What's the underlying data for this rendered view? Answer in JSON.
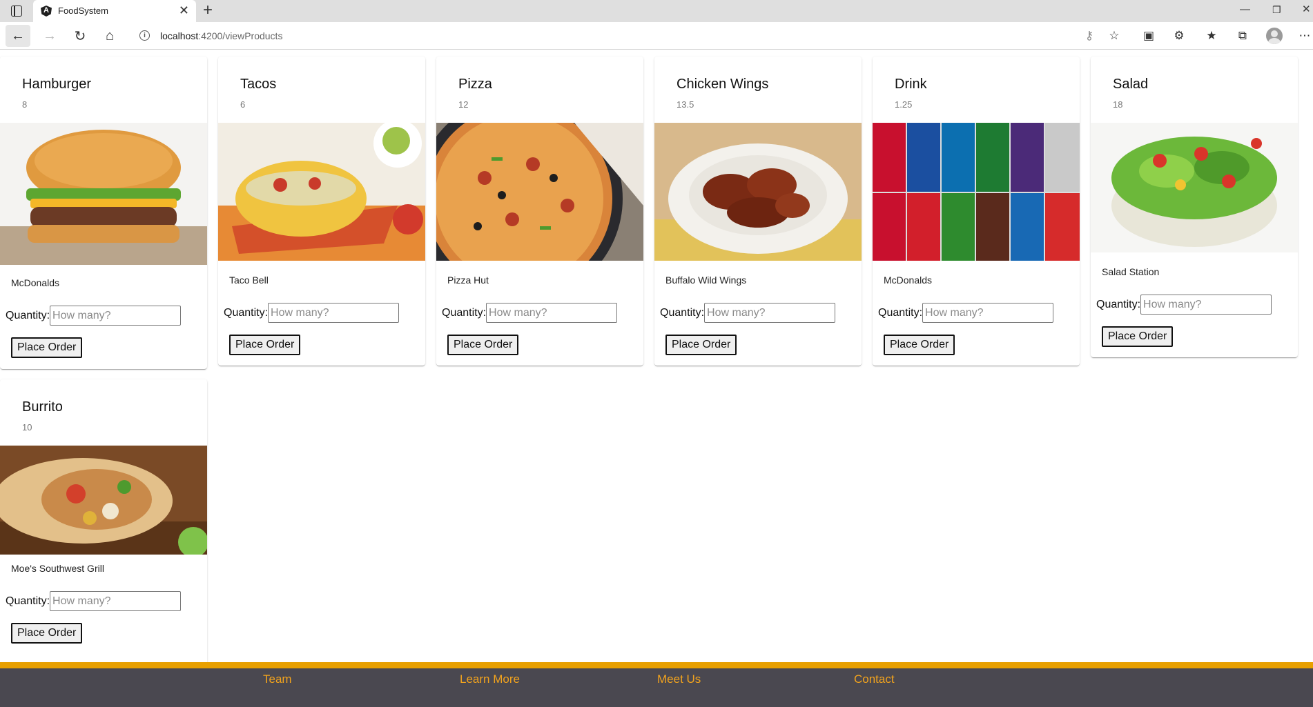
{
  "browser": {
    "tab_title": "FoodSystem",
    "url_host": "localhost",
    "url_rest": ":4200/viewProducts"
  },
  "order_button_label": "Place Order",
  "quantity_label": "Quantity:",
  "quantity_placeholder": "How many?",
  "products": [
    {
      "name": "Hamburger",
      "price": "8",
      "vendor": "McDonalds"
    },
    {
      "name": "Tacos",
      "price": "6",
      "vendor": "Taco Bell"
    },
    {
      "name": "Pizza",
      "price": "12",
      "vendor": "Pizza Hut"
    },
    {
      "name": "Chicken Wings",
      "price": "13.5",
      "vendor": "Buffalo Wild Wings"
    },
    {
      "name": "Drink",
      "price": "1.25",
      "vendor": "McDonalds"
    },
    {
      "name": "Salad",
      "price": "18",
      "vendor": "Salad Station"
    },
    {
      "name": "Burrito",
      "price": "10",
      "vendor": "Moe's Southwest Grill"
    }
  ],
  "footer": {
    "columns": [
      "Team",
      "Learn More",
      "Meet Us",
      "Contact"
    ],
    "colors": {
      "stripe": "#e8a000",
      "background": "#4a4850",
      "heading": "#f2a31d"
    }
  }
}
